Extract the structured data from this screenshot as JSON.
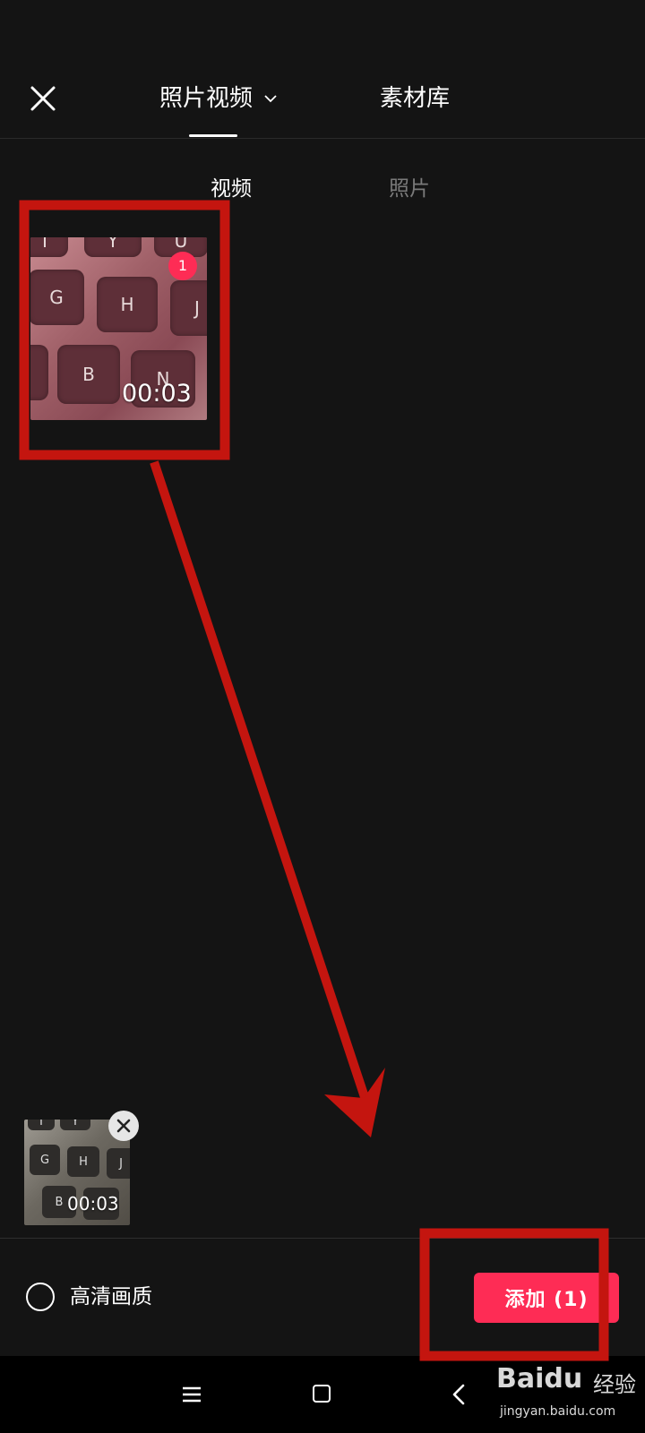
{
  "header": {
    "tab_primary": "照片视频",
    "tab_secondary": "素材库"
  },
  "subtabs": {
    "video": "视频",
    "photo": "照片"
  },
  "media": {
    "selected_index_badge": "1",
    "duration": "00:03",
    "keys_large": [
      "T",
      "Y",
      "U",
      "G",
      "H",
      "J",
      "B",
      "N"
    ],
    "keys_small": [
      "T",
      "Y",
      "G",
      "H",
      "J",
      "B"
    ]
  },
  "selection_tray": {
    "duration": "00:03"
  },
  "footer": {
    "hd_label": "高清画质",
    "add_button": "添加 (1)"
  },
  "watermark": {
    "brand_a": "Bai",
    "brand_b": "du",
    "brand_cn": "经验",
    "url": "jingyan.baidu.com"
  },
  "colors": {
    "accent": "#fe2c55",
    "annotation": "#c4150f",
    "background": "#141414"
  }
}
